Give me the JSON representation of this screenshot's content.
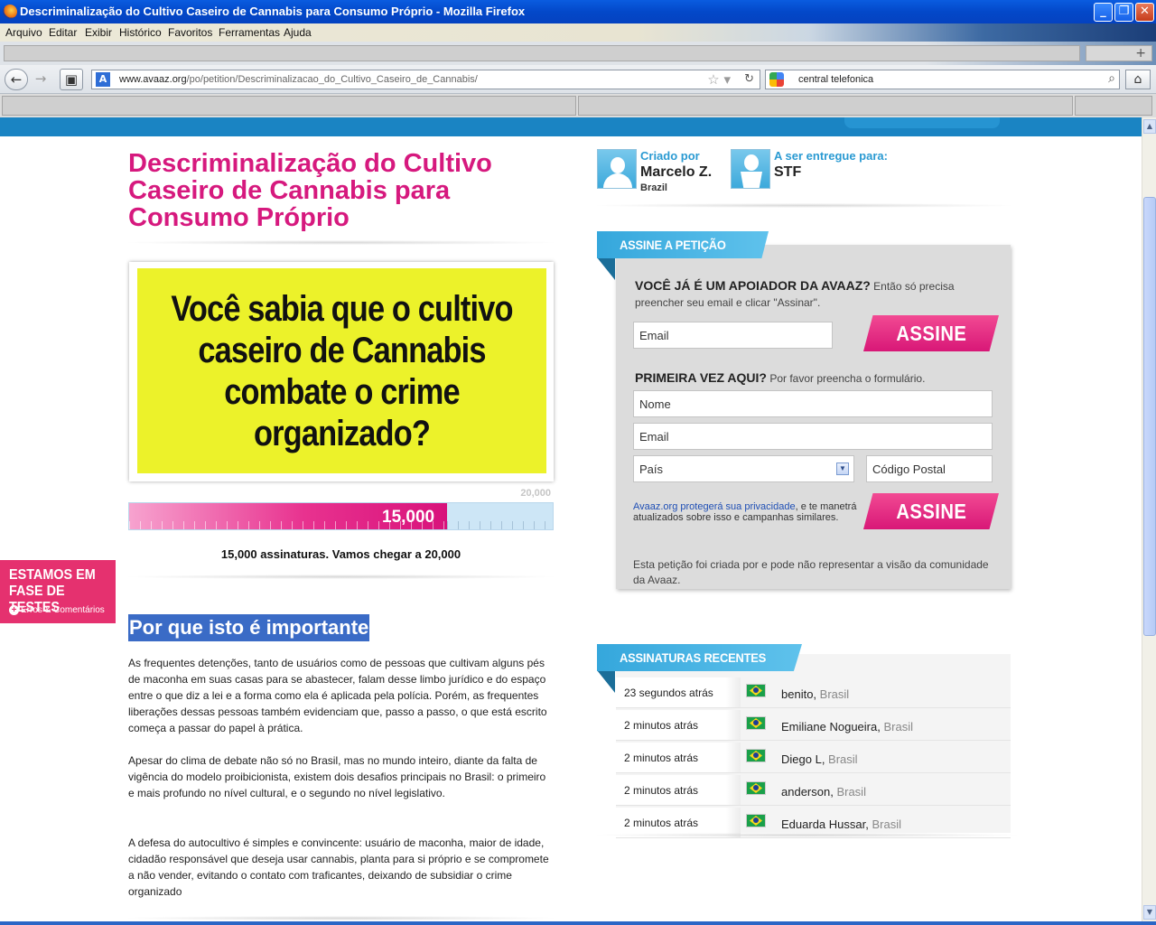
{
  "window": {
    "title": "Descriminalização do Cultivo Caseiro de Cannabis para Consumo Próprio - Mozilla Firefox",
    "minimize": "_",
    "maximize": "❐",
    "close": "✕"
  },
  "menu": [
    "Arquivo",
    "Editar",
    "Exibir",
    "Histórico",
    "Favoritos",
    "Ferramentas",
    "Ajuda"
  ],
  "nav": {
    "url_host": "www.avaaz.org",
    "url_path": "/po/petition/Descriminalizacao_do_Cultivo_Caseiro_de_Cannabis/",
    "search_value": "central telefonica"
  },
  "petition": {
    "title": "Descriminalização do Cultivo Caseiro de Cannabis para Consumo Próprio",
    "image_text": "Você sabia que o cultivo caseiro de Cannabis combate o crime organizado?",
    "goal_label": "20,000",
    "count_label": "15,000",
    "progress_fraction": 0.75,
    "summary": "15,000 assinaturas. Vamos chegar a 20,000",
    "why_heading": "Por que isto é importante",
    "paragraphs": [
      "As frequentes detenções, tanto de usuários como de pessoas que cultivam alguns pés de maconha em suas casas para se abastecer, falam desse limbo jurídico e do espaço entre o que diz a lei e a forma como ela é aplicada pela polícia. Porém, as frequentes liberações dessas pessoas também evidenciam que, passo a passo, o que está escrito começa a passar do papel à prática.",
      "Apesar do clima de debate não só no Brasil, mas no mundo inteiro, diante da falta de vigência do modelo proibicionista, existem dois desafios principais no Brasil: o primeiro e mais profundo no nível cultural, e o segundo no nível legislativo.",
      "A defesa do autocultivo é simples e convincente: usuário de maconha, maior de idade, cidadão responsável que deseja usar cannabis, planta para si próprio e se compromete a não vender, evitando o contato com traficantes, deixando de subsidiar o crime organizado"
    ]
  },
  "creator": {
    "label": "Criado por",
    "name": "Marcelo Z.",
    "country": "Brazil",
    "target_label": "A ser entregue para:",
    "target_name": "STF"
  },
  "test_badge": {
    "line1": "ESTAMOS EM FASE DE TESTES",
    "line2": "Erros & Comentários"
  },
  "sign": {
    "ribbon": "ASSINE A PETIÇÃO",
    "existing_q": "VOCÊ JÁ É UM APOIADOR DA AVAAZ?",
    "existing_hint": "Então só precisa preencher seu email e clicar \"Assinar\".",
    "email_placeholder": "Email",
    "button": "ASSINE",
    "new_q": "PRIMEIRA VEZ AQUI?",
    "new_hint": "Por favor preencha o formulário.",
    "name_placeholder": "Nome",
    "email2_placeholder": "Email",
    "country_selected": "País",
    "postal_placeholder": "Código Postal",
    "privacy_link": "Avaaz.org protegerá sua privacidade",
    "privacy_rest": ", e te manetrá atualizados sobre isso e campanhas similares.",
    "disclaimer": "Esta petição foi criada por e pode não representar a visão da comunidade da Avaaz."
  },
  "recent": {
    "ribbon": "ASSINATURAS RECENTES",
    "rows": [
      {
        "time": "23 segundos atrás",
        "name": "benito",
        "country": "Brasil"
      },
      {
        "time": "2 minutos atrás",
        "name": "Emiliane Nogueira",
        "country": "Brasil"
      },
      {
        "time": "2 minutos atrás",
        "name": "Diego L",
        "country": "Brasil"
      },
      {
        "time": "2 minutos atrás",
        "name": "anderson",
        "country": "Brasil"
      },
      {
        "time": "2 minutos atrás",
        "name": "Eduarda Hussar",
        "country": "Brasil"
      }
    ]
  },
  "colors": {
    "brand_pink": "#d6197e",
    "brand_blue": "#1a84c3",
    "ribbon_blue": "#35a7dc"
  }
}
